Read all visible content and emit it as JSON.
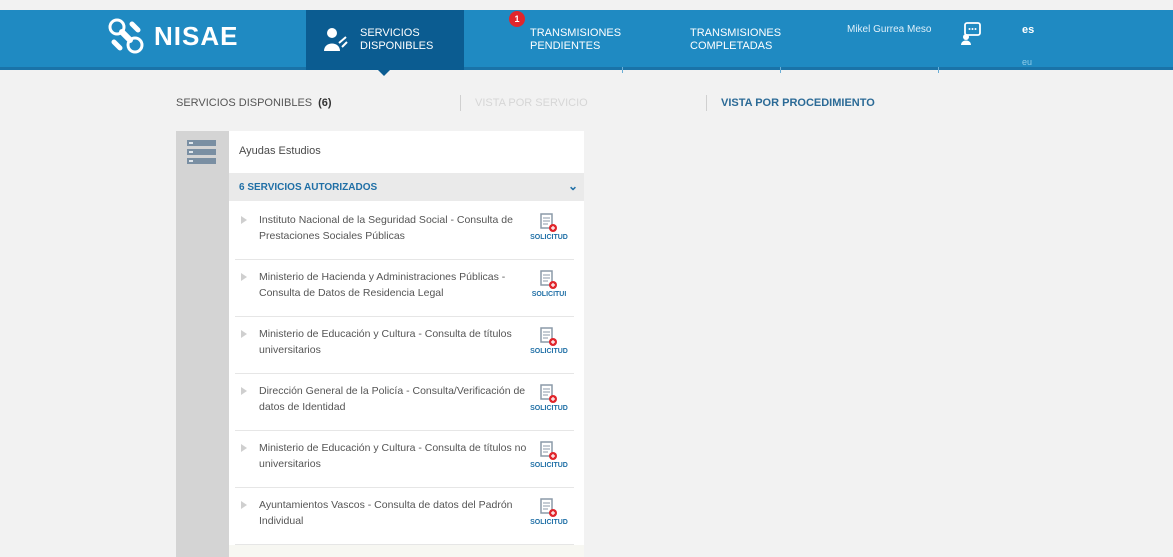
{
  "header": {
    "brand": "NISAE",
    "nav": {
      "servicios": "SERVICIOS DISPONIBLES",
      "pendientes_badge": "1",
      "pendientes": "TRANSMISIONES PENDIENTES",
      "completadas": "TRANSMISIONES COMPLETADAS"
    },
    "user": "Mikel Gurrea Meso",
    "languages": {
      "active": "es",
      "other": "eu"
    }
  },
  "subbar": {
    "title": "SERVICIOS DISPONIBLES",
    "count": "(6)",
    "view_service": "VISTA POR SERVICIO",
    "view_procedure": "VISTA POR PROCEDIMIENTO"
  },
  "panel": {
    "group_title": "Ayudas Estudios",
    "authorized": "6 SERVICIOS AUTORIZADOS",
    "services": [
      {
        "text": "Instituto Nacional de la Seguridad Social - Consulta de Prestaciones Sociales Públicas",
        "action": "SOLICITUD"
      },
      {
        "text": "Ministerio de Hacienda y Administraciones Públicas - Consulta de Datos de Residencia Legal",
        "action": "SOLICITUI"
      },
      {
        "text": "Ministerio de Educación y Cultura - Consulta de títulos universitarios",
        "action": "SOLICITUD"
      },
      {
        "text": "Dirección General de la Policía - Consulta/Verificación de datos de Identidad",
        "action": "SOLICITUD"
      },
      {
        "text": "Ministerio de Educación y Cultura - Consulta de títulos no universitarios",
        "action": "SOLICITUD"
      },
      {
        "text": "Ayuntamientos Vascos - Consulta de datos del Padrón Individual",
        "action": "SOLICITUD"
      }
    ]
  },
  "colors": {
    "header": "#1f8ac2",
    "active_tab": "#0b5c91",
    "badge": "#e0262c",
    "accent": "#1f6fa6"
  },
  "icons": [
    "puzzle-logo-icon",
    "user-services-icon",
    "support-chat-icon",
    "list-grid-icon",
    "chevron-down-icon",
    "request-document-icon"
  ]
}
